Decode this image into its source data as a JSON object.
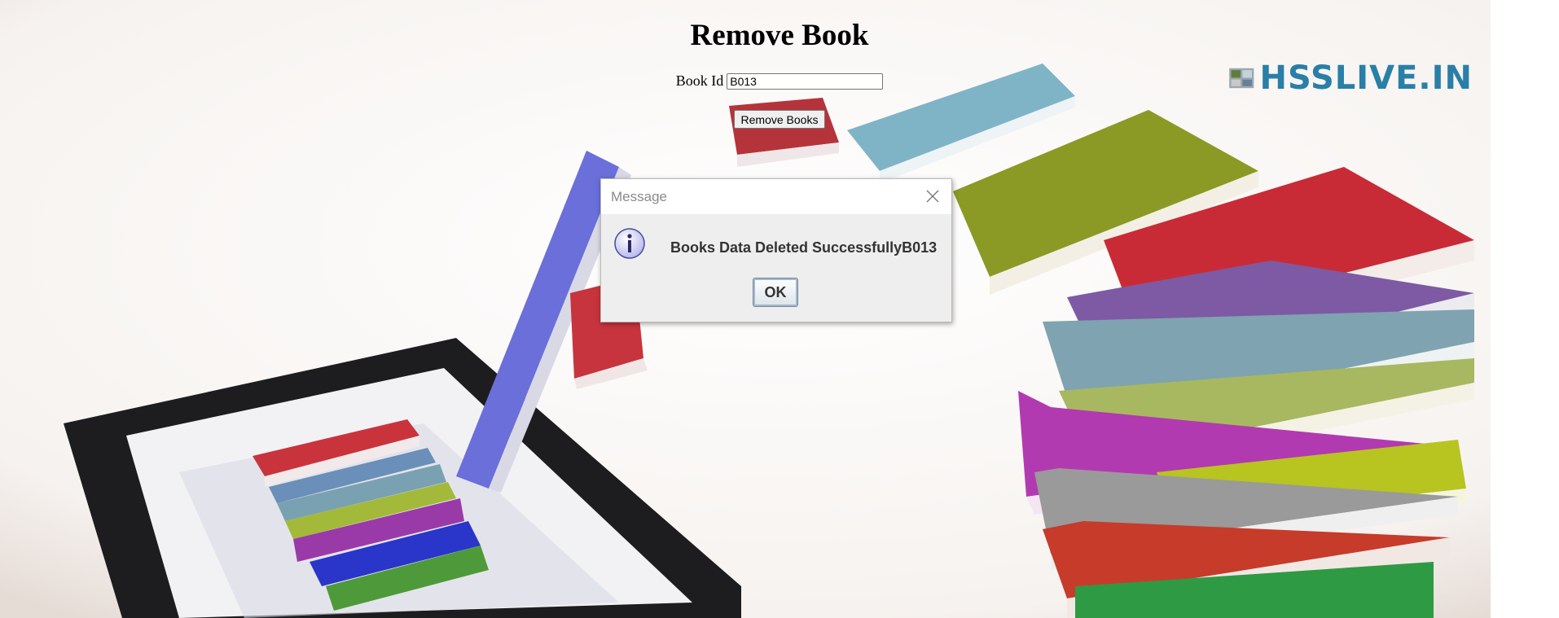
{
  "page": {
    "title": "Remove Book",
    "book_id_label": "Book Id",
    "book_id_value": "B013",
    "remove_button_label": "Remove Books"
  },
  "logo": {
    "text": "HSSLIVE.IN",
    "color": "#2a7fa6"
  },
  "dialog": {
    "title": "Message",
    "message": "Books Data Deleted SuccessfullyB013",
    "ok_label": "OK",
    "icon": "info-icon",
    "close_icon": "close-icon"
  }
}
